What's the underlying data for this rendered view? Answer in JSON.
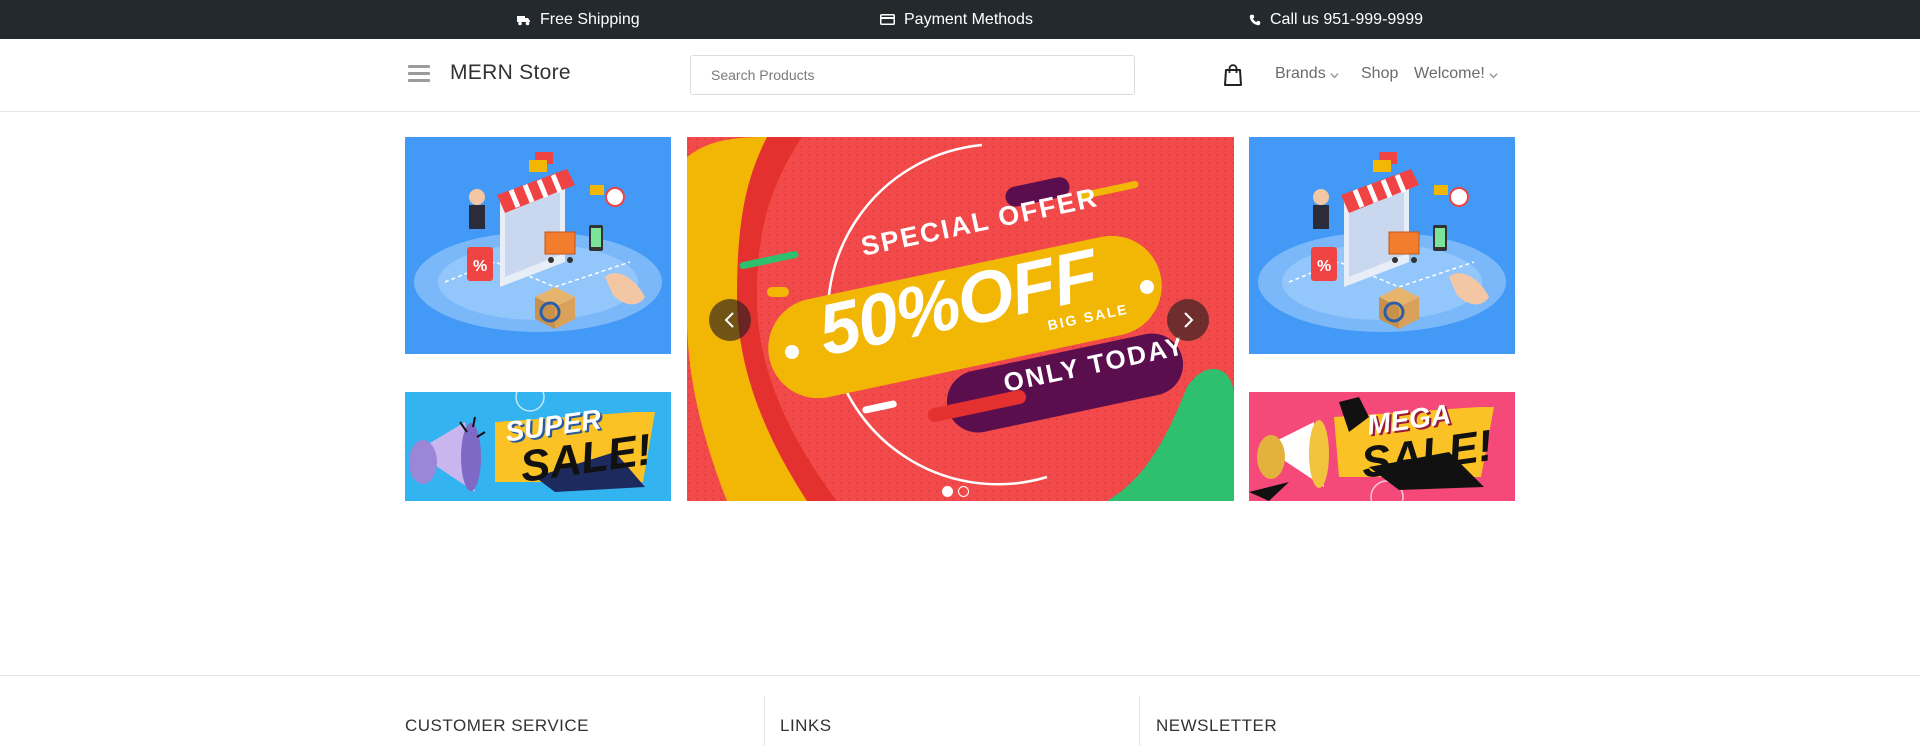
{
  "topbar": {
    "shipping": "Free Shipping",
    "payment": "Payment Methods",
    "call": "Call us 951-999-9999"
  },
  "header": {
    "logo": "MERN Store",
    "search_placeholder": "Search Products",
    "nav": {
      "brands": "Brands",
      "shop": "Shop",
      "welcome": "Welcome!"
    }
  },
  "hero": {
    "slider": {
      "line1": "SPECIAL OFFER",
      "line2": "50%OFF",
      "line3": "BIG SALE",
      "line4": "ONLY TODAY",
      "slides_total": 2,
      "active_slide": 1
    },
    "banner_left": {
      "word1": "SUPER",
      "word2": "SALE!"
    },
    "banner_right": {
      "word1": "MEGA",
      "word2": "SALE!"
    }
  },
  "footer": {
    "col1": "CUSTOMER SERVICE",
    "col2": "LINKS",
    "col3": "NEWSLETTER"
  },
  "colors": {
    "topbar_bg": "#24292e",
    "hero_blue": "#4299f6",
    "slider_red": "#f24a4a",
    "slider_yellow": "#f2b705",
    "slider_purple": "#5b0e4e",
    "slider_green": "#2ebf6f",
    "banner_pink": "#f5497a",
    "banner_sky": "#33b3ef"
  }
}
